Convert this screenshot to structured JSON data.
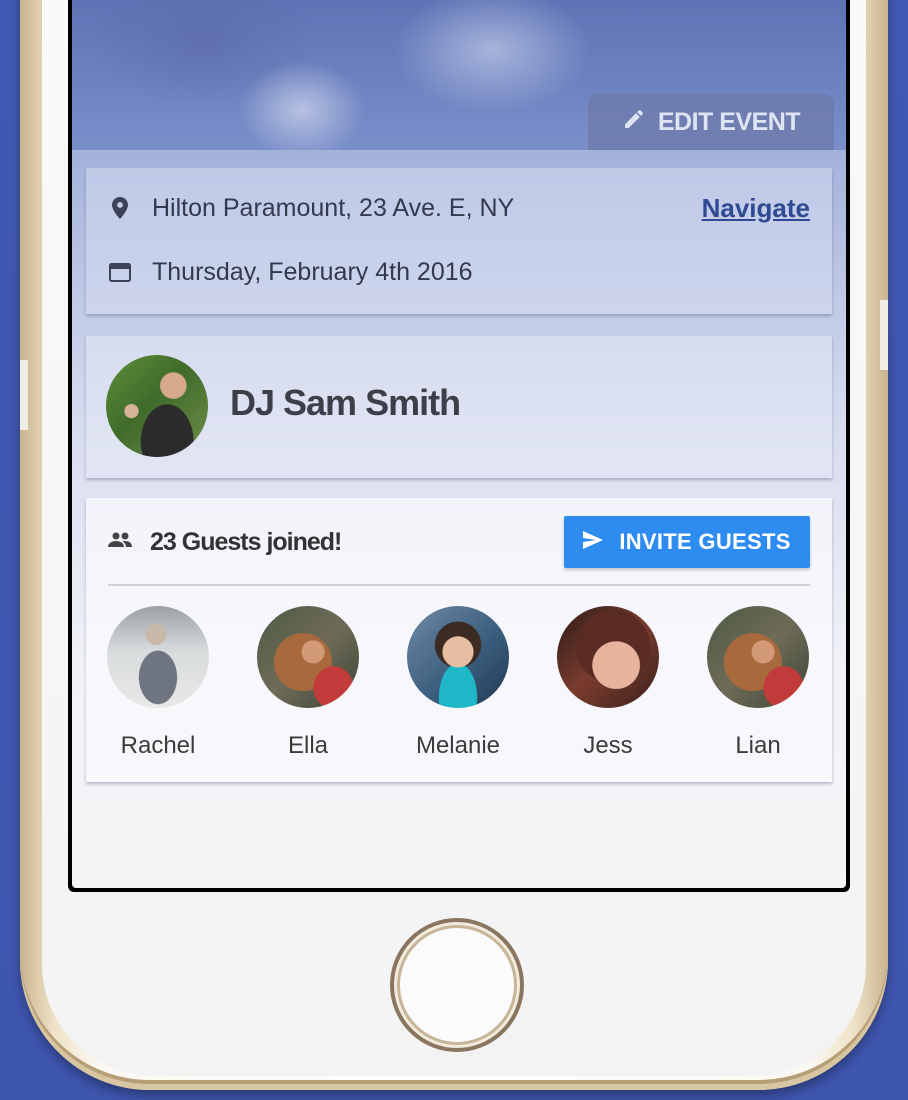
{
  "header": {
    "edit_label": "EDIT EVENT"
  },
  "event": {
    "location": "Hilton Paramount, 23 Ave. E, NY",
    "navigate_label": "Navigate",
    "date": "Thursday, February 4th 2016"
  },
  "dj": {
    "name": "DJ Sam Smith"
  },
  "guests": {
    "count_text": "23 Guests joined!",
    "invite_label": "INVITE GUESTS",
    "list": [
      {
        "name": "Rachel"
      },
      {
        "name": "Ella"
      },
      {
        "name": "Melanie"
      },
      {
        "name": "Jess"
      },
      {
        "name": "Lian"
      }
    ]
  },
  "colors": {
    "accent": "#2e8cf0",
    "link": "#2f4a93",
    "background": "#4159b3"
  },
  "icons": {
    "edit": "pencil-icon",
    "location": "map-pin-icon",
    "date": "calendar-icon",
    "guests": "people-icon",
    "invite": "send-icon"
  }
}
